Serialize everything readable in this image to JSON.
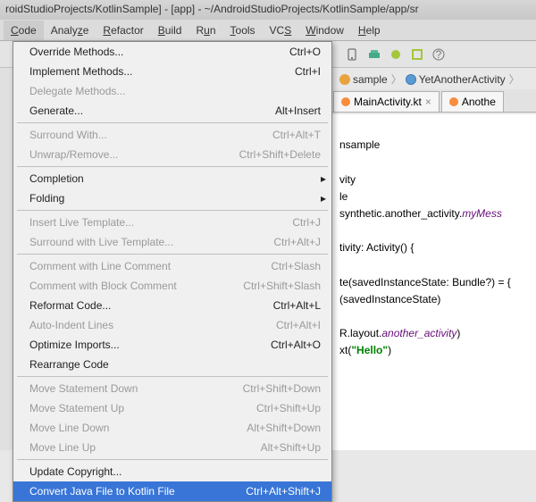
{
  "title": "roidStudioProjects/KotlinSample] - [app] - ~/AndroidStudioProjects/KotlinSample/app/sr",
  "menubar": [
    "Code",
    "Analyze",
    "Refactor",
    "Build",
    "Run",
    "Tools",
    "VCS",
    "Window",
    "Help"
  ],
  "breadcrumb": {
    "items": [
      "sample",
      "YetAnotherActivity"
    ]
  },
  "tabs": [
    {
      "label": "MainActivity.kt",
      "icon": "kotlin"
    },
    {
      "label": "Anothe",
      "icon": "kotlin"
    }
  ],
  "dropdown": [
    {
      "label": "Override Methods...",
      "shortcut": "Ctrl+O",
      "enabled": true
    },
    {
      "label": "Implement Methods...",
      "shortcut": "Ctrl+I",
      "enabled": true
    },
    {
      "label": "Delegate Methods...",
      "shortcut": "",
      "enabled": false
    },
    {
      "label": "Generate...",
      "shortcut": "Alt+Insert",
      "enabled": true
    },
    {
      "sep": true
    },
    {
      "label": "Surround With...",
      "shortcut": "Ctrl+Alt+T",
      "enabled": false
    },
    {
      "label": "Unwrap/Remove...",
      "shortcut": "Ctrl+Shift+Delete",
      "enabled": false
    },
    {
      "sep": true
    },
    {
      "label": "Completion",
      "shortcut": "",
      "enabled": true,
      "submenu": true
    },
    {
      "label": "Folding",
      "shortcut": "",
      "enabled": true,
      "submenu": true
    },
    {
      "sep": true
    },
    {
      "label": "Insert Live Template...",
      "shortcut": "Ctrl+J",
      "enabled": false
    },
    {
      "label": "Surround with Live Template...",
      "shortcut": "Ctrl+Alt+J",
      "enabled": false
    },
    {
      "sep": true
    },
    {
      "label": "Comment with Line Comment",
      "shortcut": "Ctrl+Slash",
      "enabled": false
    },
    {
      "label": "Comment with Block Comment",
      "shortcut": "Ctrl+Shift+Slash",
      "enabled": false
    },
    {
      "label": "Reformat Code...",
      "shortcut": "Ctrl+Alt+L",
      "enabled": true
    },
    {
      "label": "Auto-Indent Lines",
      "shortcut": "Ctrl+Alt+I",
      "enabled": false
    },
    {
      "label": "Optimize Imports...",
      "shortcut": "Ctrl+Alt+O",
      "enabled": true
    },
    {
      "label": "Rearrange Code",
      "shortcut": "",
      "enabled": true
    },
    {
      "sep": true
    },
    {
      "label": "Move Statement Down",
      "shortcut": "Ctrl+Shift+Down",
      "enabled": false
    },
    {
      "label": "Move Statement Up",
      "shortcut": "Ctrl+Shift+Up",
      "enabled": false
    },
    {
      "label": "Move Line Down",
      "shortcut": "Alt+Shift+Down",
      "enabled": false
    },
    {
      "label": "Move Line Up",
      "shortcut": "Alt+Shift+Up",
      "enabled": false
    },
    {
      "sep": true
    },
    {
      "label": "Update Copyright...",
      "shortcut": "",
      "enabled": true
    },
    {
      "label": "Convert Java File to Kotlin File",
      "shortcut": "Ctrl+Alt+Shift+J",
      "enabled": true,
      "selected": true
    }
  ],
  "code": {
    "l1": "nsample",
    "l2": "vity",
    "l3": "le",
    "l4a": "synthetic.another_activity.",
    "l4b": "myMess",
    "l5a": "tivity: Activity() {",
    "l6a": "te(savedInstanceState: Bundle?) = {",
    "l6b": "(savedInstanceState)",
    "l7a": "R.layout.",
    "l7b": "another_activity",
    "l7c": ")",
    "l8a": "xt(",
    "l8b": "\"Hello\"",
    "l8c": ")"
  },
  "tabs_close": "×"
}
